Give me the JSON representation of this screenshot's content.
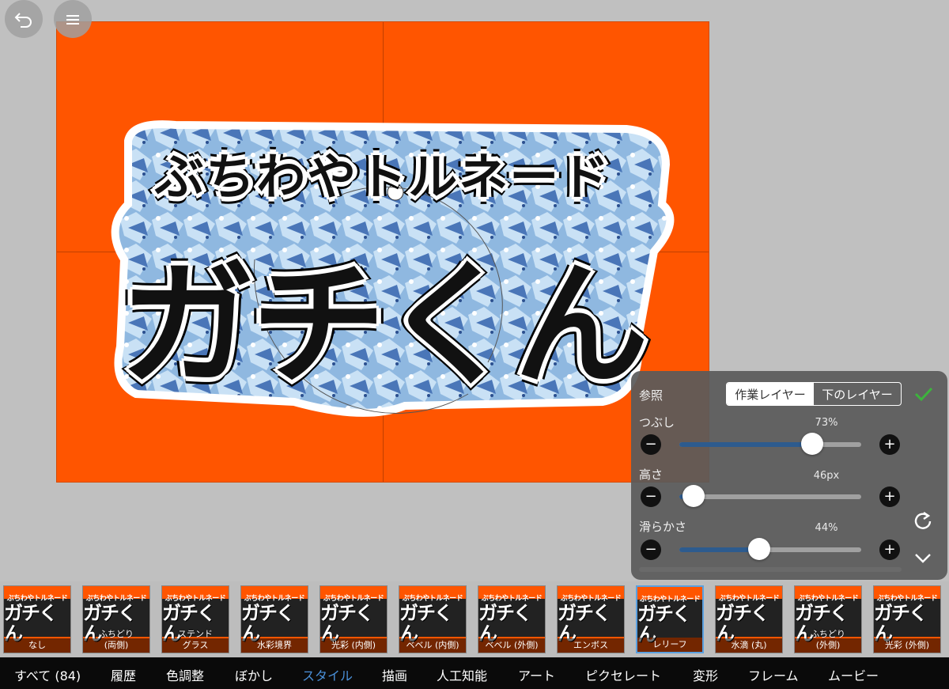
{
  "toolbar": {
    "undo_icon": "undo-arrow-icon",
    "menu_icon": "menu-lines-icon"
  },
  "canvas": {
    "background_color": "#ff5500",
    "logo_line1": "ぶちわやトルネード",
    "logo_line2": "ガチくん"
  },
  "panel": {
    "reference_label": "参照",
    "segments": [
      "作業レイヤー",
      "下のレイヤー"
    ],
    "sliders": [
      {
        "label": "つぶし",
        "value_text": "73%",
        "fraction": 0.73
      },
      {
        "label": "高さ",
        "value_text": "46px",
        "fraction": 0.08
      },
      {
        "label": "滑らかさ",
        "value_text": "44%",
        "fraction": 0.44
      }
    ],
    "accent_color": "#2d5b8e",
    "confirm_color": "#3db33d"
  },
  "thumbs": [
    {
      "label": "なし",
      "sub": ""
    },
    {
      "label": "(両側)",
      "sub": "ふちどり"
    },
    {
      "label": "グラス",
      "sub": "ステンド"
    },
    {
      "label": "水彩境界",
      "sub": ""
    },
    {
      "label": "光彩 (内側)",
      "sub": ""
    },
    {
      "label": "ベベル (内側)",
      "sub": ""
    },
    {
      "label": "ベベル (外側)",
      "sub": ""
    },
    {
      "label": "エンボス",
      "sub": ""
    },
    {
      "label": "レリーフ",
      "sub": ""
    },
    {
      "label": "水滴 (丸)",
      "sub": ""
    },
    {
      "label": "(外側)",
      "sub": "ふちどり"
    },
    {
      "label": "光彩 (外側)",
      "sub": ""
    }
  ],
  "thumb_art": {
    "t1": "ぶちわやトルネード",
    "t2": "ガチくん"
  },
  "tabs": [
    {
      "label": "すべて (84)",
      "active": false
    },
    {
      "label": "履歴",
      "active": false
    },
    {
      "label": "色調整",
      "active": false
    },
    {
      "label": "ぼかし",
      "active": false
    },
    {
      "label": "スタイル",
      "active": true
    },
    {
      "label": "描画",
      "active": false
    },
    {
      "label": "人工知能",
      "active": false
    },
    {
      "label": "アート",
      "active": false
    },
    {
      "label": "ピクセレート",
      "active": false
    },
    {
      "label": "変形",
      "active": false
    },
    {
      "label": "フレーム",
      "active": false
    },
    {
      "label": "ムービー",
      "active": false
    }
  ]
}
